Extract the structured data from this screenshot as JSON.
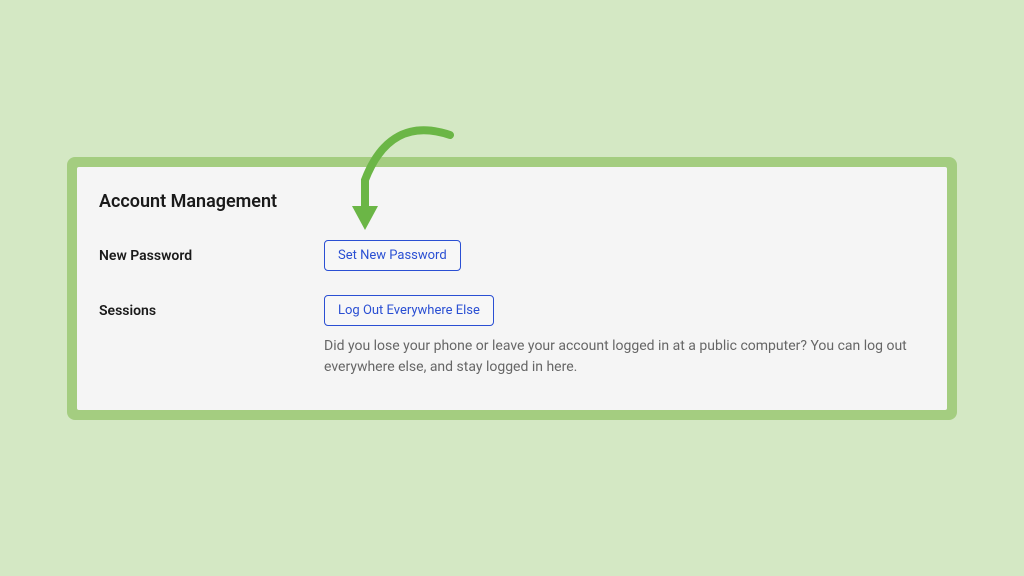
{
  "panel": {
    "title": "Account Management",
    "rows": {
      "password": {
        "label": "New Password",
        "button": "Set New Password"
      },
      "sessions": {
        "label": "Sessions",
        "button": "Log Out Everywhere Else",
        "help": "Did you lose your phone or leave your account logged in at a public computer? You can log out everywhere else, and stay logged in here."
      }
    }
  },
  "annotation": {
    "arrow_color": "#6bb646"
  }
}
